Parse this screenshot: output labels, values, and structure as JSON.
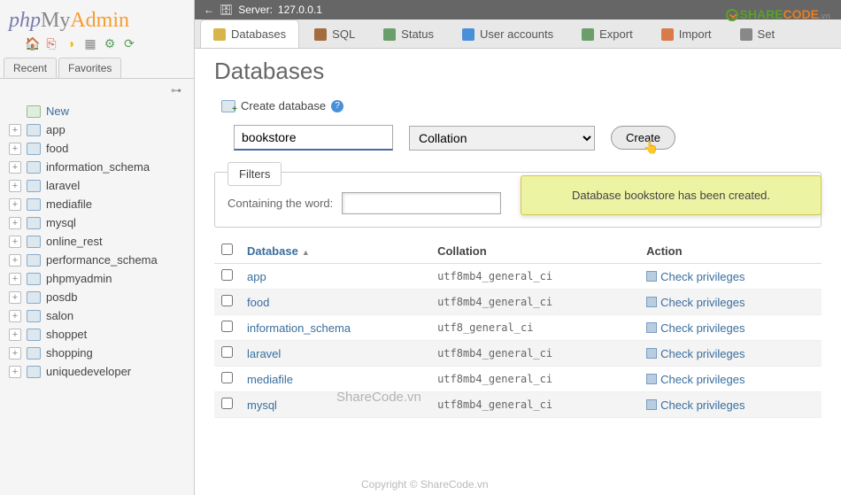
{
  "brand_watermark": {
    "part1": "SHARE",
    "part2": "CODE",
    "part3": ".vn"
  },
  "logo": {
    "php": "php",
    "my": "My",
    "admin": "Admin"
  },
  "side_tabs": {
    "recent": "Recent",
    "favorites": "Favorites"
  },
  "tree": [
    {
      "label": "New",
      "new": true
    },
    {
      "label": "app"
    },
    {
      "label": "food"
    },
    {
      "label": "information_schema"
    },
    {
      "label": "laravel"
    },
    {
      "label": "mediafile"
    },
    {
      "label": "mysql"
    },
    {
      "label": "online_rest"
    },
    {
      "label": "performance_schema"
    },
    {
      "label": "phpmyadmin"
    },
    {
      "label": "posdb"
    },
    {
      "label": "salon"
    },
    {
      "label": "shoppet"
    },
    {
      "label": "shopping"
    },
    {
      "label": "uniquedeveloper"
    }
  ],
  "server": {
    "prefix": "Server:",
    "addr": "127.0.0.1"
  },
  "tabs": [
    {
      "label": "Databases",
      "active": true
    },
    {
      "label": "SQL"
    },
    {
      "label": "Status"
    },
    {
      "label": "User accounts"
    },
    {
      "label": "Export"
    },
    {
      "label": "Import"
    },
    {
      "label": "Set"
    }
  ],
  "page_title": "Databases",
  "create": {
    "title": "Create database",
    "dbname": "bookstore",
    "collation_placeholder": "Collation",
    "button": "Create"
  },
  "notice": "Database bookstore has been created.",
  "filters": {
    "legend": "Filters",
    "label": "Containing the word:"
  },
  "table": {
    "headers": {
      "db": "Database",
      "coll": "Collation",
      "action": "Action",
      "priv": "Check privileges"
    },
    "rows": [
      {
        "name": "app",
        "coll": "utf8mb4_general_ci"
      },
      {
        "name": "food",
        "coll": "utf8mb4_general_ci"
      },
      {
        "name": "information_schema",
        "coll": "utf8_general_ci"
      },
      {
        "name": "laravel",
        "coll": "utf8mb4_general_ci"
      },
      {
        "name": "mediafile",
        "coll": "utf8mb4_general_ci"
      },
      {
        "name": "mysql",
        "coll": "utf8mb4_general_ci"
      }
    ]
  },
  "watermarks": {
    "w1": "ShareCode.vn",
    "w2": "Copyright © ShareCode.vn"
  }
}
